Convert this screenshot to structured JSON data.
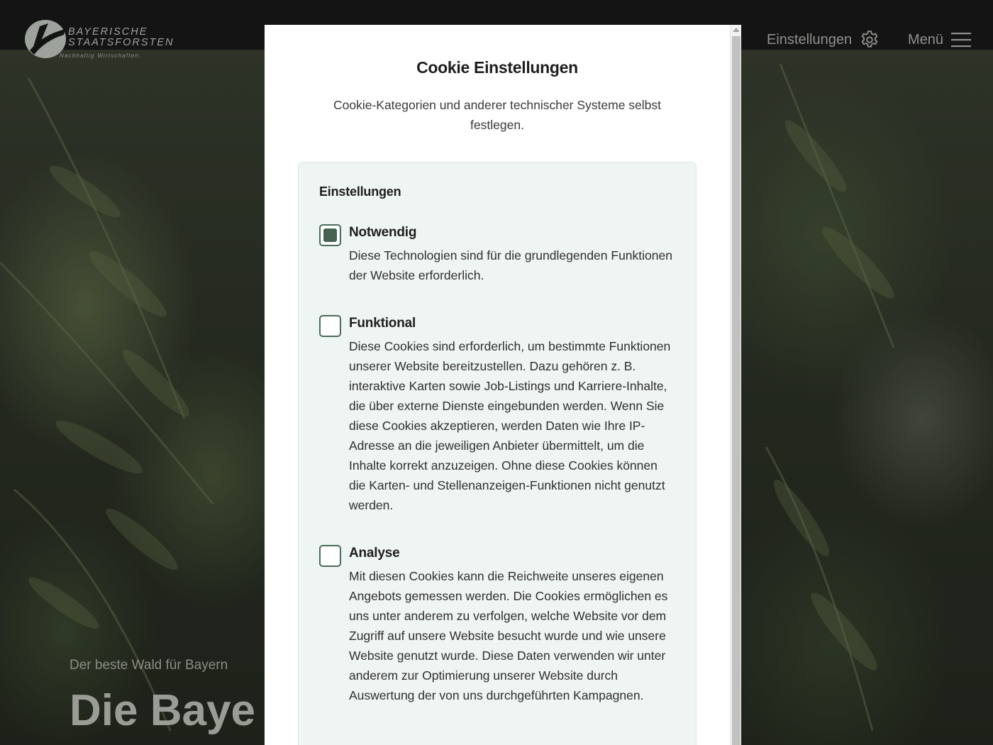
{
  "brand": {
    "line1": "BAYERISCHE",
    "line2": "STAATSFORSTEN",
    "tagline": "Nachhaltig Wirtschaften."
  },
  "nav": {
    "settings_label": "Einstellungen",
    "settings_icon": "gear-icon",
    "menu_label": "Menü",
    "menu_icon": "hamburger-icon"
  },
  "hero": {
    "subtitle": "Der beste Wald für Bayern",
    "title": "Die Baye"
  },
  "cookie_modal": {
    "title": "Cookie Einstellungen",
    "intro": "Cookie-Kategorien und anderer technischer Systeme selbst festlegen.",
    "panel_title": "Einstellungen",
    "categories": [
      {
        "label": "Notwendig",
        "checked": true,
        "description": "Diese Technologien sind für die grundlegenden Funktionen der Website erforderlich."
      },
      {
        "label": "Funktional",
        "checked": false,
        "description": "Diese Cookies sind erforderlich, um bestimmte Funktionen unserer Website bereitzustellen. Dazu gehören z. B. interaktive Karten sowie Job-Listings und Karriere-Inhalte, die über externe Dienste eingebunden werden. Wenn Sie diese Cookies akzeptieren, werden Daten wie Ihre IP-Adresse an die jeweiligen Anbieter übermittelt, um die Inhalte korrekt anzuzeigen. Ohne diese Cookies können die Karten- und Stellenanzeigen-Funktionen nicht genutzt werden."
      },
      {
        "label": "Analyse",
        "checked": false,
        "description": "Mit diesen Cookies kann die Reichweite unseres eigenen Angebots gemessen werden. Die Cookies ermöglichen es uns unter anderem zu verfolgen, welche Website vor dem Zugriff auf unsere Website besucht wurde und wie unsere Website genutzt wurde. Diese Daten verwenden wir unter anderem zur Optimierung unserer Website durch Auswertung der von uns durchgeführten Kampagnen."
      }
    ]
  },
  "colors": {
    "accent": "#46614f",
    "panel_bg": "#eff5f2",
    "topbar_bg": "#141414"
  }
}
